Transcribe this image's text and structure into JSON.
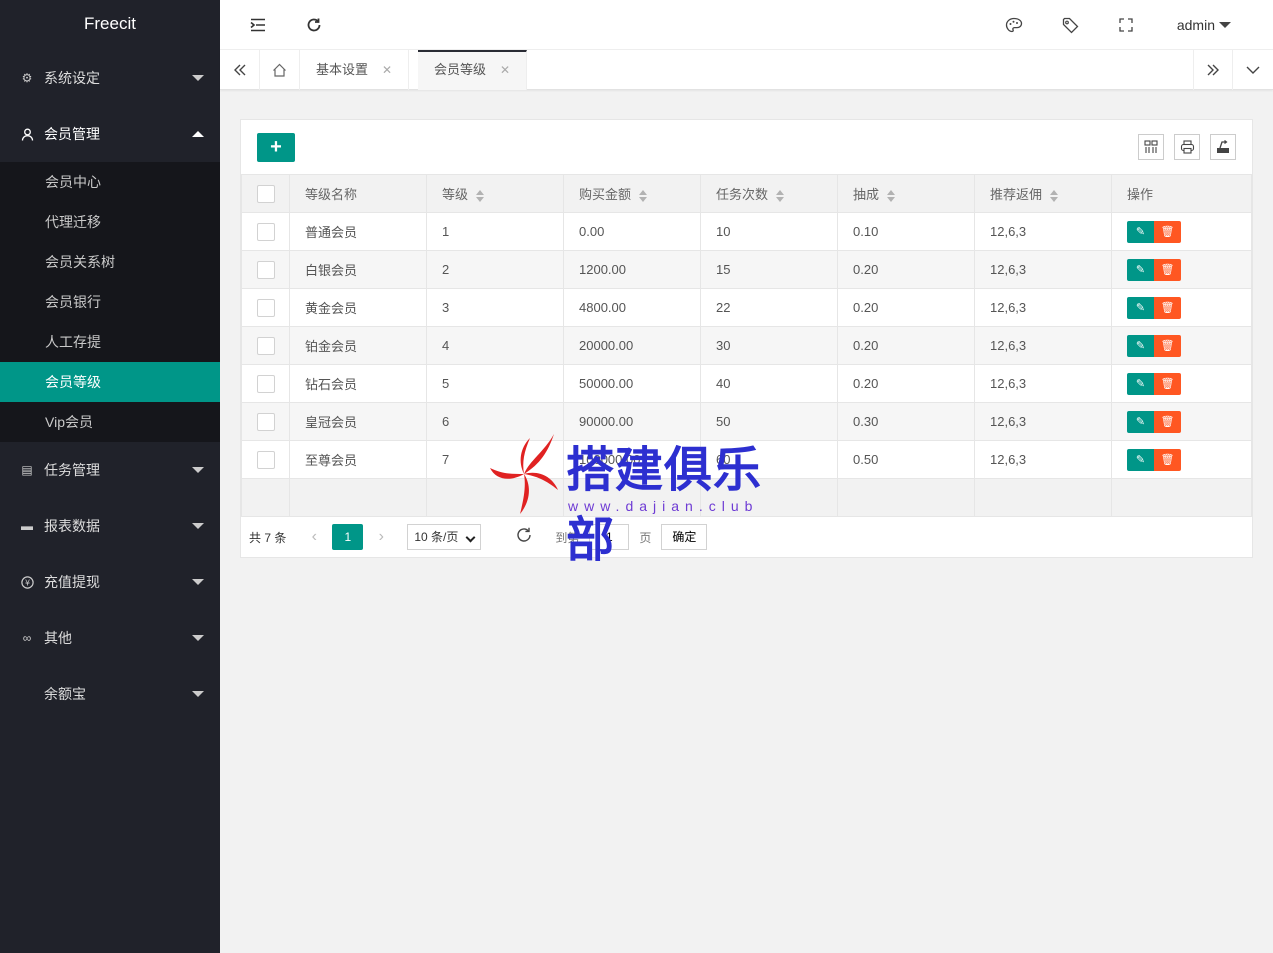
{
  "brand": "Freecit",
  "sidebar": {
    "groups": [
      {
        "label": "系统设定",
        "icon": "gear-icon"
      },
      {
        "label": "会员管理",
        "icon": "user-icon"
      },
      {
        "label": "任务管理",
        "icon": "list-icon"
      },
      {
        "label": "报表数据",
        "icon": "monitor-icon"
      },
      {
        "label": "充值提现",
        "icon": "yen-icon"
      },
      {
        "label": "其他",
        "icon": "link-icon"
      },
      {
        "label": "余额宝",
        "icon": ""
      }
    ],
    "member_items": [
      "会员中心",
      "代理迁移",
      "会员关系树",
      "会员银行",
      "人工存提",
      "会员等级",
      "Vip会员"
    ]
  },
  "header": {
    "user": "admin"
  },
  "tabs": [
    {
      "label": "基本设置"
    },
    {
      "label": "会员等级"
    }
  ],
  "table": {
    "columns": [
      "等级名称",
      "等级",
      "购买金额",
      "任务次数",
      "抽成",
      "推荐返佣",
      "操作"
    ],
    "rows": [
      {
        "name": "普通会员",
        "level": "1",
        "amount": "0.00",
        "tasks": "10",
        "rate": "0.10",
        "rebate": "12,6,3"
      },
      {
        "name": "白银会员",
        "level": "2",
        "amount": "1200.00",
        "tasks": "15",
        "rate": "0.20",
        "rebate": "12,6,3"
      },
      {
        "name": "黄金会员",
        "level": "3",
        "amount": "4800.00",
        "tasks": "22",
        "rate": "0.20",
        "rebate": "12,6,3"
      },
      {
        "name": "铂金会员",
        "level": "4",
        "amount": "20000.00",
        "tasks": "30",
        "rate": "0.20",
        "rebate": "12,6,3"
      },
      {
        "name": "钻石会员",
        "level": "5",
        "amount": "50000.00",
        "tasks": "40",
        "rate": "0.20",
        "rebate": "12,6,3"
      },
      {
        "name": "皇冠会员",
        "level": "6",
        "amount": "90000.00",
        "tasks": "50",
        "rate": "0.30",
        "rebate": "12,6,3"
      },
      {
        "name": "至尊会员",
        "level": "7",
        "amount": "100000.00",
        "tasks": "60",
        "rate": "0.50",
        "rebate": "12,6,3"
      }
    ]
  },
  "pager": {
    "count": "共 7 条",
    "current": "1",
    "per_page": "10 条/页",
    "goto_label": "到第",
    "goto_value": "1",
    "page_label": "页",
    "confirm": "确定"
  },
  "watermark": {
    "text": "搭建俱乐部",
    "url": "www.dajian.club"
  },
  "colors": {
    "accent": "#009688",
    "danger": "#ff5722",
    "sidebar": "#20222a"
  }
}
